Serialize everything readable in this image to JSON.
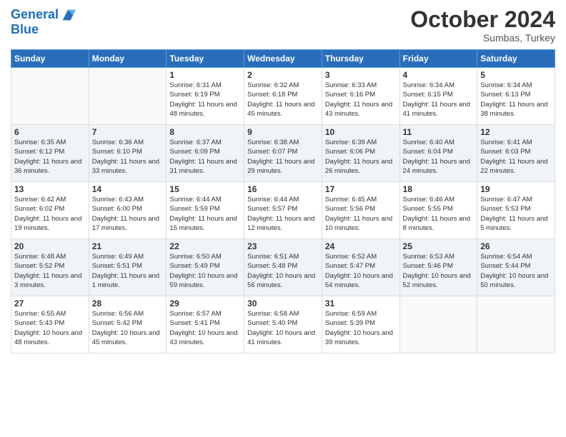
{
  "header": {
    "logo_line1": "General",
    "logo_line2": "Blue",
    "title": "October 2024",
    "subtitle": "Sumbas, Turkey"
  },
  "weekdays": [
    "Sunday",
    "Monday",
    "Tuesday",
    "Wednesday",
    "Thursday",
    "Friday",
    "Saturday"
  ],
  "weeks": [
    [
      {
        "day": "",
        "info": ""
      },
      {
        "day": "",
        "info": ""
      },
      {
        "day": "1",
        "info": "Sunrise: 6:31 AM\nSunset: 6:19 PM\nDaylight: 11 hours and 48 minutes."
      },
      {
        "day": "2",
        "info": "Sunrise: 6:32 AM\nSunset: 6:18 PM\nDaylight: 11 hours and 45 minutes."
      },
      {
        "day": "3",
        "info": "Sunrise: 6:33 AM\nSunset: 6:16 PM\nDaylight: 11 hours and 43 minutes."
      },
      {
        "day": "4",
        "info": "Sunrise: 6:34 AM\nSunset: 6:15 PM\nDaylight: 11 hours and 41 minutes."
      },
      {
        "day": "5",
        "info": "Sunrise: 6:34 AM\nSunset: 6:13 PM\nDaylight: 11 hours and 38 minutes."
      }
    ],
    [
      {
        "day": "6",
        "info": "Sunrise: 6:35 AM\nSunset: 6:12 PM\nDaylight: 11 hours and 36 minutes."
      },
      {
        "day": "7",
        "info": "Sunrise: 6:36 AM\nSunset: 6:10 PM\nDaylight: 11 hours and 33 minutes."
      },
      {
        "day": "8",
        "info": "Sunrise: 6:37 AM\nSunset: 6:09 PM\nDaylight: 11 hours and 31 minutes."
      },
      {
        "day": "9",
        "info": "Sunrise: 6:38 AM\nSunset: 6:07 PM\nDaylight: 11 hours and 29 minutes."
      },
      {
        "day": "10",
        "info": "Sunrise: 6:39 AM\nSunset: 6:06 PM\nDaylight: 11 hours and 26 minutes."
      },
      {
        "day": "11",
        "info": "Sunrise: 6:40 AM\nSunset: 6:04 PM\nDaylight: 11 hours and 24 minutes."
      },
      {
        "day": "12",
        "info": "Sunrise: 6:41 AM\nSunset: 6:03 PM\nDaylight: 11 hours and 22 minutes."
      }
    ],
    [
      {
        "day": "13",
        "info": "Sunrise: 6:42 AM\nSunset: 6:02 PM\nDaylight: 11 hours and 19 minutes."
      },
      {
        "day": "14",
        "info": "Sunrise: 6:43 AM\nSunset: 6:00 PM\nDaylight: 11 hours and 17 minutes."
      },
      {
        "day": "15",
        "info": "Sunrise: 6:44 AM\nSunset: 5:59 PM\nDaylight: 11 hours and 15 minutes."
      },
      {
        "day": "16",
        "info": "Sunrise: 6:44 AM\nSunset: 5:57 PM\nDaylight: 11 hours and 12 minutes."
      },
      {
        "day": "17",
        "info": "Sunrise: 6:45 AM\nSunset: 5:56 PM\nDaylight: 11 hours and 10 minutes."
      },
      {
        "day": "18",
        "info": "Sunrise: 6:46 AM\nSunset: 5:55 PM\nDaylight: 11 hours and 8 minutes."
      },
      {
        "day": "19",
        "info": "Sunrise: 6:47 AM\nSunset: 5:53 PM\nDaylight: 11 hours and 5 minutes."
      }
    ],
    [
      {
        "day": "20",
        "info": "Sunrise: 6:48 AM\nSunset: 5:52 PM\nDaylight: 11 hours and 3 minutes."
      },
      {
        "day": "21",
        "info": "Sunrise: 6:49 AM\nSunset: 5:51 PM\nDaylight: 11 hours and 1 minute."
      },
      {
        "day": "22",
        "info": "Sunrise: 6:50 AM\nSunset: 5:49 PM\nDaylight: 10 hours and 59 minutes."
      },
      {
        "day": "23",
        "info": "Sunrise: 6:51 AM\nSunset: 5:48 PM\nDaylight: 10 hours and 56 minutes."
      },
      {
        "day": "24",
        "info": "Sunrise: 6:52 AM\nSunset: 5:47 PM\nDaylight: 10 hours and 54 minutes."
      },
      {
        "day": "25",
        "info": "Sunrise: 6:53 AM\nSunset: 5:46 PM\nDaylight: 10 hours and 52 minutes."
      },
      {
        "day": "26",
        "info": "Sunrise: 6:54 AM\nSunset: 5:44 PM\nDaylight: 10 hours and 50 minutes."
      }
    ],
    [
      {
        "day": "27",
        "info": "Sunrise: 6:55 AM\nSunset: 5:43 PM\nDaylight: 10 hours and 48 minutes."
      },
      {
        "day": "28",
        "info": "Sunrise: 6:56 AM\nSunset: 5:42 PM\nDaylight: 10 hours and 45 minutes."
      },
      {
        "day": "29",
        "info": "Sunrise: 6:57 AM\nSunset: 5:41 PM\nDaylight: 10 hours and 43 minutes."
      },
      {
        "day": "30",
        "info": "Sunrise: 6:58 AM\nSunset: 5:40 PM\nDaylight: 10 hours and 41 minutes."
      },
      {
        "day": "31",
        "info": "Sunrise: 6:59 AM\nSunset: 5:39 PM\nDaylight: 10 hours and 39 minutes."
      },
      {
        "day": "",
        "info": ""
      },
      {
        "day": "",
        "info": ""
      }
    ]
  ]
}
